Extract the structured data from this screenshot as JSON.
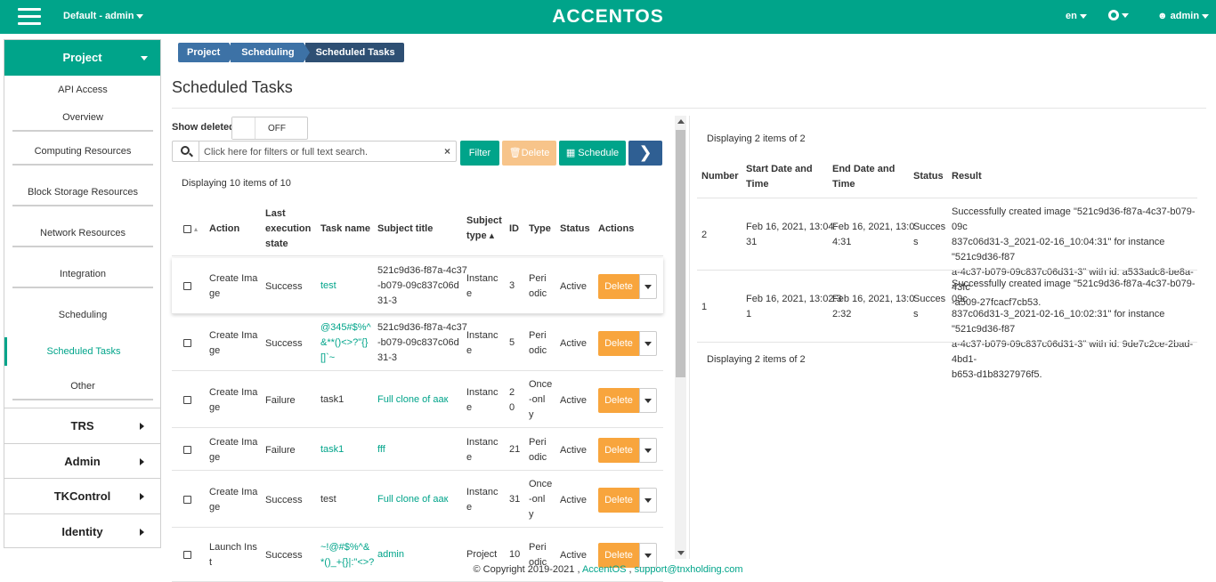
{
  "topbar": {
    "project_selector": "Default - admin",
    "logo": "ACCENTOS",
    "language": "en",
    "user": "admin"
  },
  "sidebar": {
    "project_label": "Project",
    "items": [
      {
        "label": "API Access"
      },
      {
        "label": "Overview"
      },
      {
        "label": "Computing Resources"
      },
      {
        "label": "Block Storage Resources"
      },
      {
        "label": "Network Resources"
      },
      {
        "label": "Integration"
      },
      {
        "label": "Scheduling"
      },
      {
        "label": "Scheduled Tasks"
      },
      {
        "label": "Other"
      }
    ],
    "groups": [
      {
        "label": "TRS"
      },
      {
        "label": "Admin"
      },
      {
        "label": "TKControl"
      },
      {
        "label": "Identity"
      }
    ]
  },
  "breadcrumb": [
    "Project",
    "Scheduling",
    "Scheduled Tasks"
  ],
  "page_title": "Scheduled Tasks",
  "controls": {
    "show_deleted_label": "Show deleted",
    "toggle_state": "OFF",
    "search_placeholder": "Click here for filters or full text search.",
    "clear_icon": "×",
    "filter_label": "Filter",
    "delete_label": "Delete",
    "schedule_label": "Schedule",
    "next_icon": "❯"
  },
  "tasks": {
    "displaying": "Displaying 10 items of 10",
    "headers": {
      "action": "Action",
      "last_state": [
        "Last",
        "execution",
        "state"
      ],
      "task_name": "Task name",
      "subject_title": "Subject title",
      "subject_type": [
        "Subject",
        "type ▴"
      ],
      "id": "ID",
      "type": "Type",
      "status": "Status",
      "actions": "Actions"
    },
    "rows": [
      {
        "action": [
          "Create Ima",
          "ge"
        ],
        "state": "Success",
        "name": [
          "test"
        ],
        "name_link": true,
        "subject": [
          "521c9d36-f87a-4c37",
          "-b079-09c837c06d",
          "31-3"
        ],
        "subject_link": false,
        "stype": [
          "Instanc",
          "e"
        ],
        "id": [
          "3"
        ],
        "type": [
          "Peri",
          "odic"
        ],
        "status": "Active",
        "btn": "Delete"
      },
      {
        "action": [
          "Create Ima",
          "ge"
        ],
        "state": "Success",
        "name": [
          "@345#$%^",
          "&**()<>?\"{}",
          "[]`~"
        ],
        "name_link": true,
        "subject": [
          "521c9d36-f87a-4c37",
          "-b079-09c837c06d",
          "31-3"
        ],
        "subject_link": false,
        "stype": [
          "Instanc",
          "e"
        ],
        "id": [
          "5"
        ],
        "type": [
          "Peri",
          "odic"
        ],
        "status": "Active",
        "btn": "Delete"
      },
      {
        "action": [
          "Create Ima",
          "ge"
        ],
        "state": "Failure",
        "name": [
          "task1"
        ],
        "name_link": false,
        "subject": [
          "Full clone of aaк"
        ],
        "subject_link": true,
        "stype": [
          "Instanc",
          "e"
        ],
        "id": [
          "2",
          "0"
        ],
        "type": [
          "Once",
          "-onl",
          "y"
        ],
        "status": "Active",
        "btn": "Delete"
      },
      {
        "action": [
          "Create Ima",
          "ge"
        ],
        "state": "Failure",
        "name": [
          "task1"
        ],
        "name_link": true,
        "subject": [
          "fff"
        ],
        "subject_link": true,
        "stype": [
          "Instanc",
          "e"
        ],
        "id": [
          "21"
        ],
        "type": [
          "Peri",
          "odic"
        ],
        "status": "Active",
        "btn": "Delete"
      },
      {
        "action": [
          "Create Ima",
          "ge"
        ],
        "state": "Success",
        "name": [
          "test"
        ],
        "name_link": false,
        "subject": [
          "Full clone of aaк"
        ],
        "subject_link": true,
        "stype": [
          "Instanc",
          "e"
        ],
        "id": [
          "31"
        ],
        "type": [
          "Once",
          "-onl",
          "y"
        ],
        "status": "Active",
        "btn": "Delete"
      },
      {
        "action": [
          "Launch Ins",
          "t"
        ],
        "state": "Success",
        "name": [
          "~!@#$%^&",
          "*()_+{}|:\"<>?"
        ],
        "name_link": true,
        "subject": [
          "admin"
        ],
        "subject_link": true,
        "stype": [
          "Project"
        ],
        "id": [
          "10"
        ],
        "type": [
          "Peri",
          "odic"
        ],
        "status": "Active",
        "btn": "Delete"
      }
    ]
  },
  "results": {
    "displaying_top": "Displaying 2 items of 2",
    "displaying_bottom": "Displaying 2 items of 2",
    "headers": {
      "number": "Number",
      "start": [
        "Start Date and",
        "Time"
      ],
      "end": [
        "End Date and",
        "Time"
      ],
      "status": "Status",
      "result": "Result"
    },
    "rows": [
      {
        "number": "2",
        "start": [
          "Feb 16, 2021, 13:04:",
          "31"
        ],
        "end": [
          "Feb 16, 2021, 13:0",
          "4:31"
        ],
        "status": [
          "Succes",
          "s"
        ],
        "result": [
          "Successfully created image \"521c9d36-f87a-4c37-b079-09c",
          "837c06d31-3_2021-02-16_10:04:31\" for instance \"521c9d36-f87",
          "a-4c37-b079-09c837c06d31-3\" with id: a533adc8-be8a-43fc",
          "-a509-27fcacf7cb53."
        ]
      },
      {
        "number": "1",
        "start": [
          "Feb 16, 2021, 13:02:3",
          "1"
        ],
        "end": [
          "Feb 16, 2021, 13:0",
          "2:32"
        ],
        "status": [
          "Succes",
          "s"
        ],
        "result": [
          "Successfully created image \"521c9d36-f87a-4c37-b079-09c",
          "837c06d31-3_2021-02-16_10:02:31\" for instance \"521c9d36-f87",
          "a-4c37-b079-09c837c06d31-3\" with id: 9de7c2ce-2bad-4bd1-",
          "b653-d1b8327976f5."
        ]
      }
    ]
  },
  "footer": {
    "copyright": "© Copyright 2019-2021 ,",
    "brand": "AccentOS",
    "sep": ",",
    "email": "support@tnxholding.com"
  }
}
